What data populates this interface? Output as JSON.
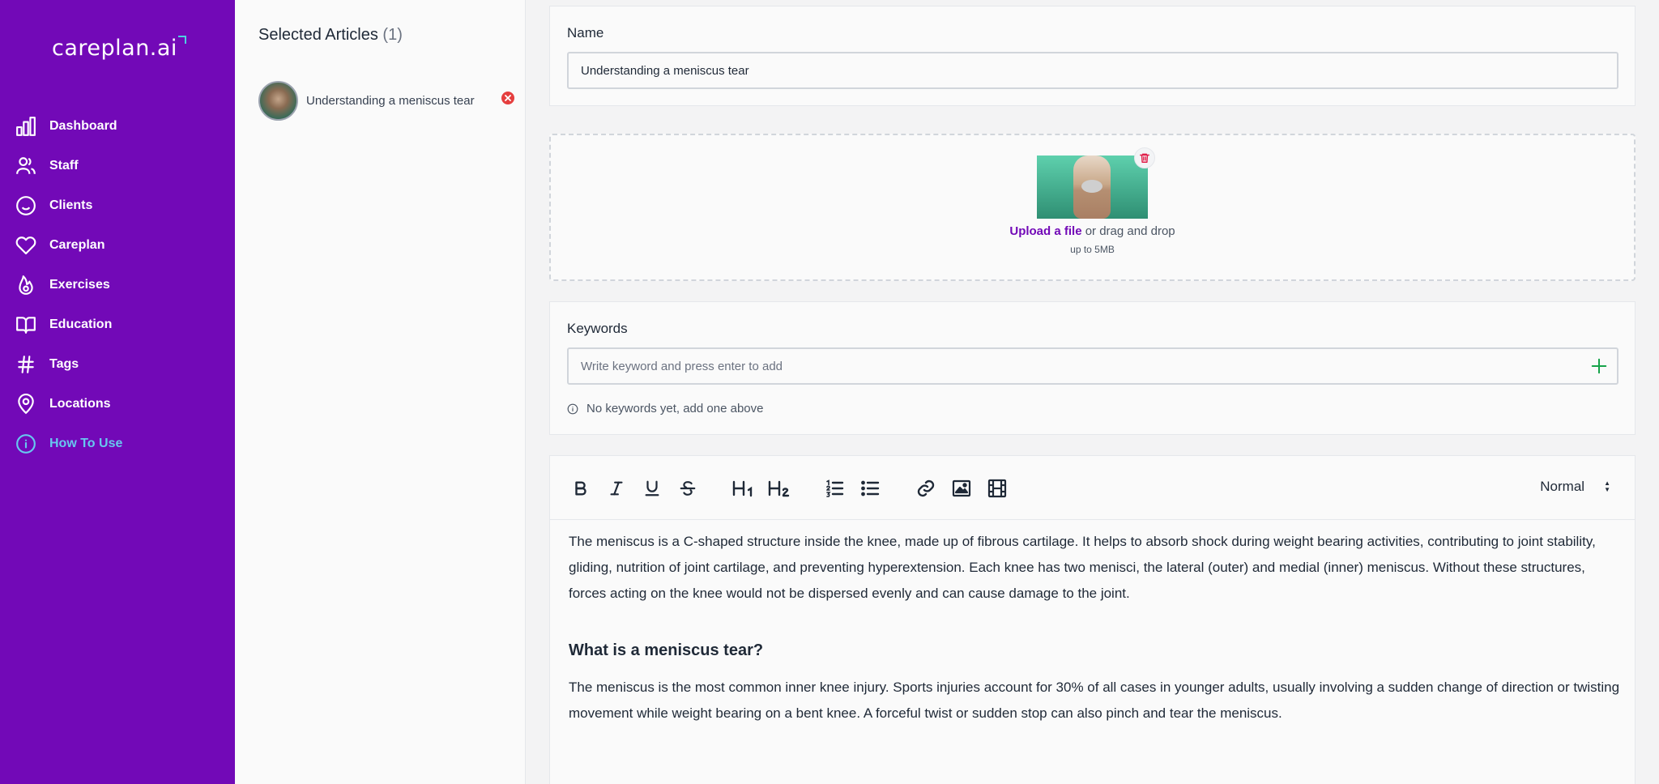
{
  "app": {
    "logo": "careplan.ai"
  },
  "sidebar": {
    "items": [
      {
        "label": "Dashboard",
        "icon": "dashboard-icon",
        "active": false
      },
      {
        "label": "Staff",
        "icon": "users-icon",
        "active": false
      },
      {
        "label": "Clients",
        "icon": "smile-icon",
        "active": false
      },
      {
        "label": "Careplan",
        "icon": "heart-icon",
        "active": false
      },
      {
        "label": "Exercises",
        "icon": "flame-icon",
        "active": false
      },
      {
        "label": "Education",
        "icon": "book-icon",
        "active": false
      },
      {
        "label": "Tags",
        "icon": "hashtag-icon",
        "active": false
      },
      {
        "label": "Locations",
        "icon": "location-pin-icon",
        "active": false
      },
      {
        "label": "How To Use",
        "icon": "info-circle-icon",
        "active": true
      }
    ]
  },
  "selected_articles": {
    "title": "Selected Articles",
    "count": "(1)",
    "items": [
      {
        "title": "Understanding a meniscus tear"
      }
    ]
  },
  "form": {
    "name_label": "Name",
    "name_value": "Understanding a meniscus tear",
    "upload": {
      "link": "Upload a file",
      "text": " or drag and drop",
      "note": "up to 5MB"
    },
    "keywords_label": "Keywords",
    "keywords_placeholder": "Write keyword and press enter to add",
    "keywords_empty": "No keywords yet, add one above"
  },
  "editor": {
    "toolbar": {
      "style_value": "Normal"
    },
    "content": {
      "p1": "The meniscus is a C-shaped structure inside the knee, made up of fibrous cartilage. It helps to absorb shock during weight bearing activities, contributing to joint stability, gliding, nutrition of joint cartilage, and preventing hyperextension. Each knee has two menisci, the lateral (outer) and medial (inner) meniscus. Without these structures, forces acting on the knee would not be dispersed evenly and can cause damage to the joint.",
      "h1": "What is a meniscus tear?",
      "p2": "The meniscus is the most common inner knee injury. Sports injuries account for 30% of all cases in younger adults, usually involving a sudden change of direction or twisting movement while weight bearing on a bent knee. A forceful twist or sudden stop can also pinch and tear the meniscus."
    }
  },
  "colors": {
    "sidebar_bg": "#7209b7",
    "active_nav": "#67c7ef",
    "link": "#7209b7",
    "danger": "#e53e3e",
    "success": "#16a34a"
  }
}
